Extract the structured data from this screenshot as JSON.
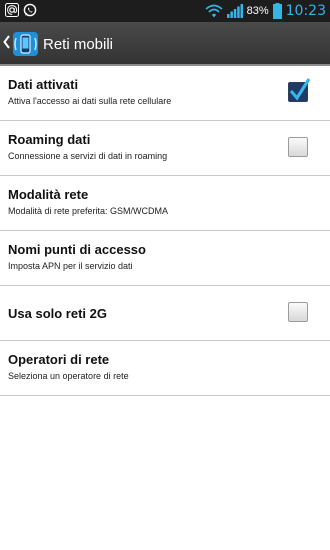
{
  "status_bar": {
    "battery_percent": "83%",
    "time": "10:23",
    "icons": [
      "at-sign-icon",
      "whatsapp-icon",
      "wifi-icon",
      "signal-icon",
      "battery-icon"
    ]
  },
  "action_bar": {
    "title": "Reti mobili",
    "icon": "mobile-network-icon"
  },
  "settings": [
    {
      "title": "Dati attivati",
      "subtitle": "Attiva l'accesso ai dati sulla rete cellulare",
      "checked": true
    },
    {
      "title": "Roaming dati",
      "subtitle": "Connessione a servizi di dati in roaming",
      "checked": false
    },
    {
      "title": "Modalità rete",
      "subtitle": "Modalità di rete preferita: GSM/WCDMA"
    },
    {
      "title": "Nomi punti di accesso",
      "subtitle": "Imposta APN per il servizio dati"
    },
    {
      "title": "Usa solo reti 2G",
      "checked": false
    },
    {
      "title": "Operatori di rete",
      "subtitle": "Seleziona un operatore di rete"
    }
  ],
  "colors": {
    "clock": "#33b5e5",
    "checkmark": "#35b6e8",
    "checkbox_checked_bg": "#1e3a66"
  }
}
